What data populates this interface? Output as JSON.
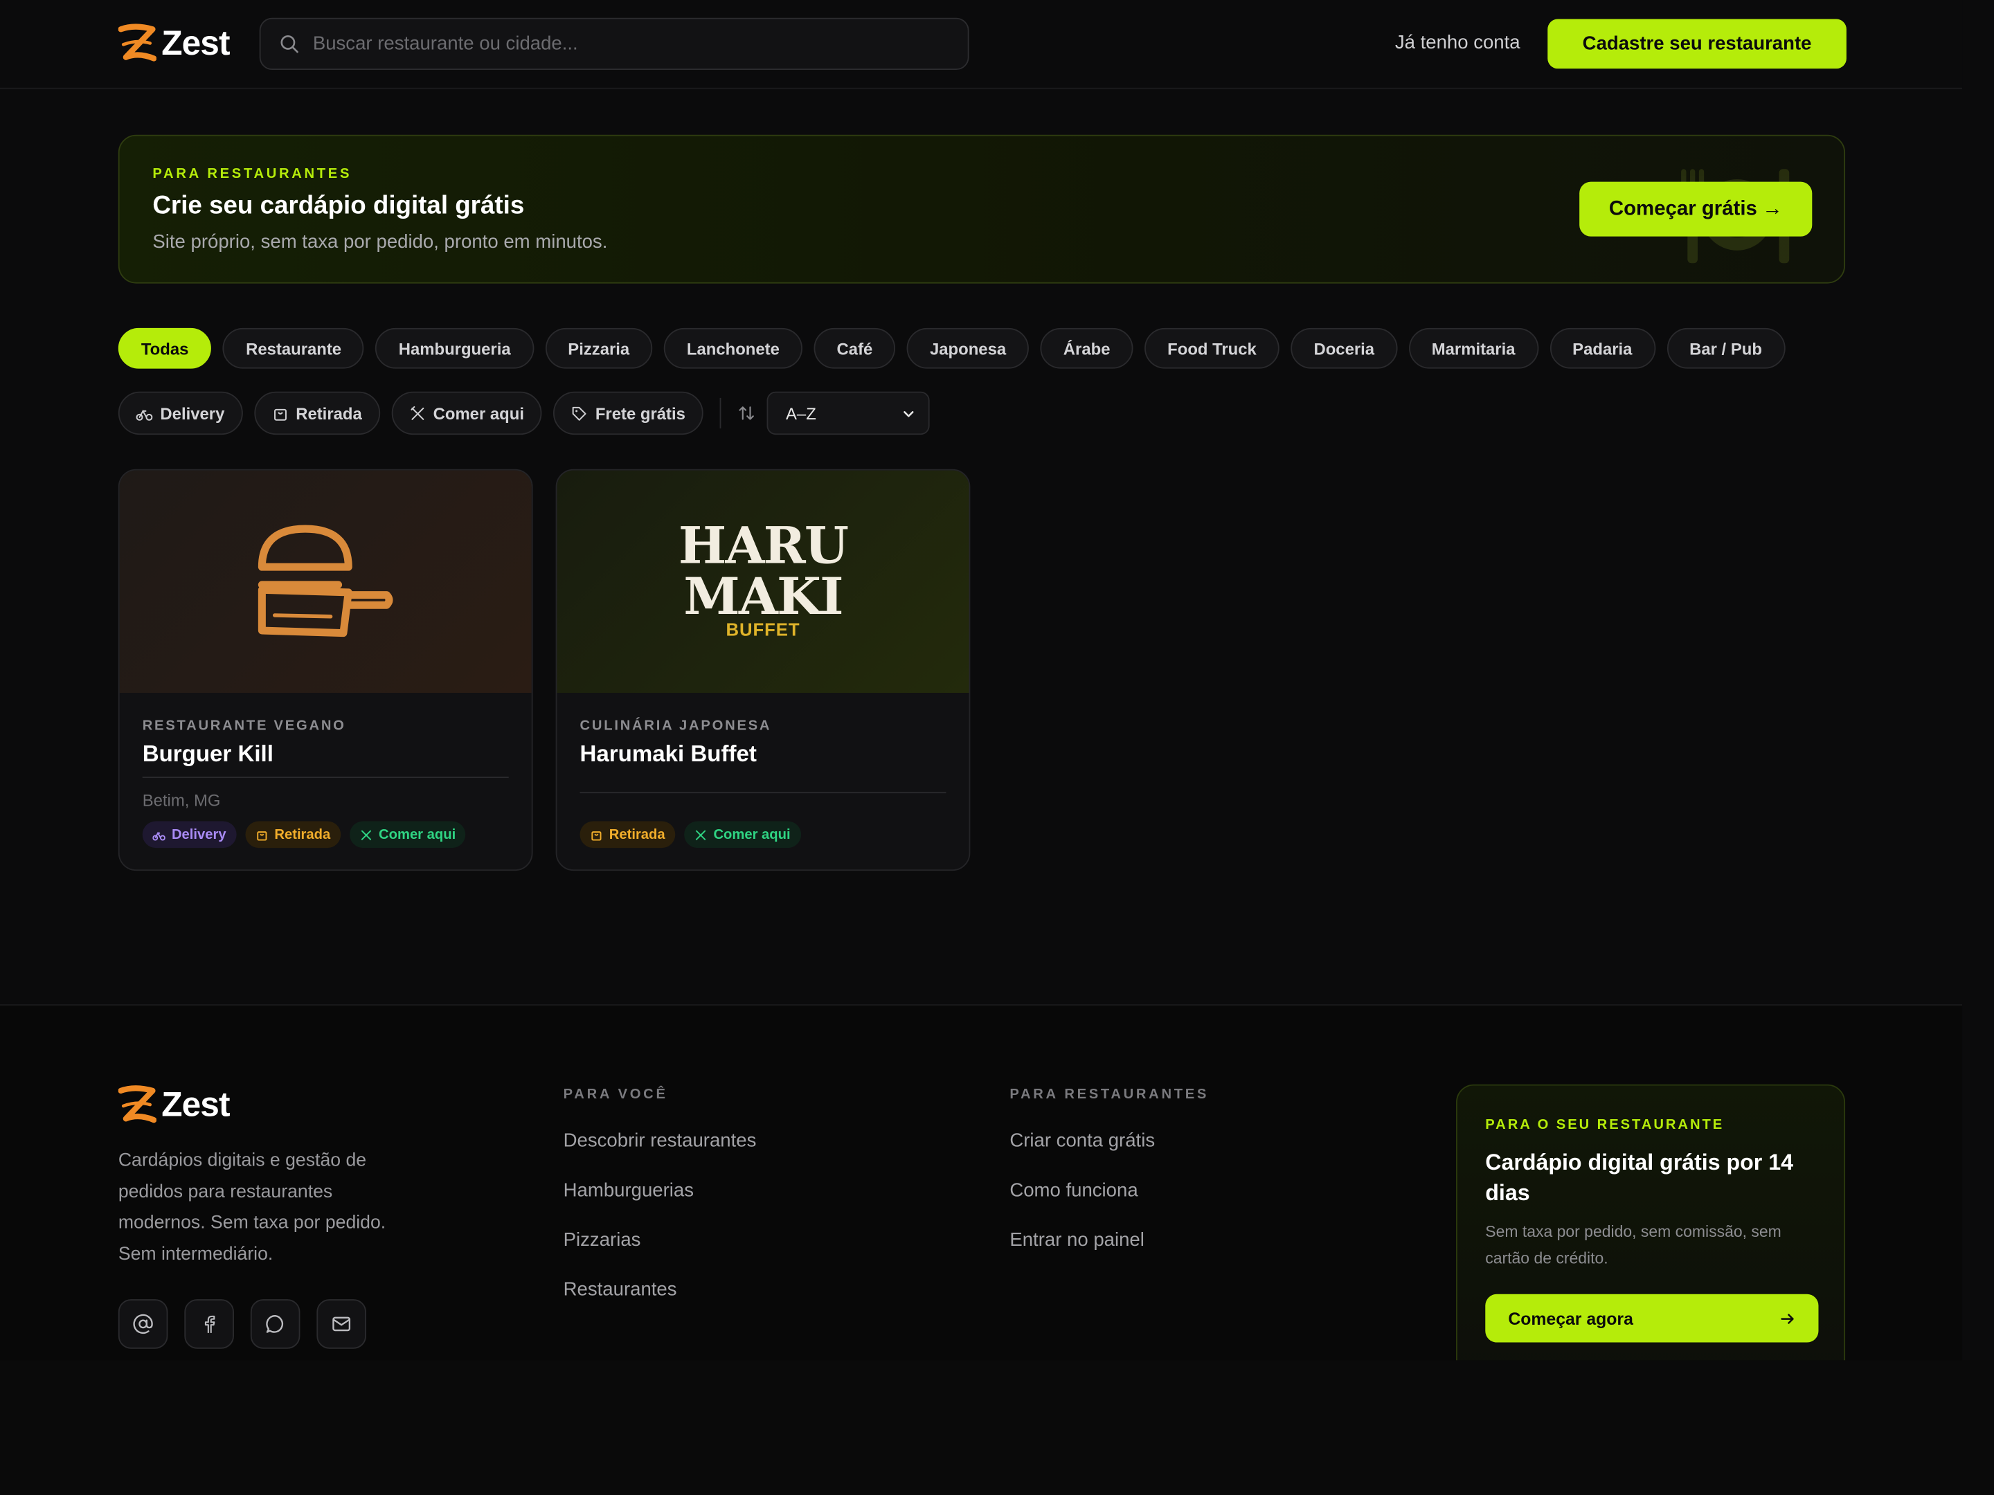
{
  "brand": {
    "name": "Zest",
    "accent": "#b5ec0a",
    "logo_color": "#f08a24"
  },
  "header": {
    "search_placeholder": "Buscar restaurante ou cidade...",
    "login_label": "Já tenho conta",
    "cta_label": "Cadastre seu restaurante"
  },
  "banner": {
    "kicker": "PARA RESTAURANTES",
    "title": "Crie seu cardápio digital grátis",
    "subtitle": "Site próprio, sem taxa por pedido, pronto em minutos.",
    "button_label": "Começar grátis",
    "button_arrow": "→"
  },
  "categories": [
    "Todas",
    "Restaurante",
    "Hamburgueria",
    "Pizzaria",
    "Lanchonete",
    "Café",
    "Japonesa",
    "Árabe",
    "Food Truck",
    "Doceria",
    "Marmitaria",
    "Padaria",
    "Bar / Pub"
  ],
  "filters": {
    "delivery": "Delivery",
    "retirada": "Retirada",
    "comer": "Comer aqui",
    "frete": "Frete grátis",
    "sort_value": "A–Z"
  },
  "cards": [
    {
      "category": "RESTAURANTE VEGANO",
      "name": "Burguer Kill",
      "location": "Betim, MG",
      "tag_delivery": "Delivery",
      "tag_retirada": "Retirada",
      "tag_comer": "Comer aqui"
    },
    {
      "category": "CULINÁRIA JAPONESA",
      "name": "Harumaki Buffet",
      "logo_line1": "HARU",
      "logo_line2": "MAKI",
      "logo_line3": "BUFFET",
      "tag_retirada": "Retirada",
      "tag_comer": "Comer aqui"
    }
  ],
  "footer": {
    "brand_name": "Zest",
    "description": "Cardápios digitais e gestão de pedidos para restaurantes modernos. Sem taxa por pedido. Sem intermediário.",
    "col1_title": "PARA VOCÊ",
    "col1_links": [
      "Descobrir restaurantes",
      "Hamburguerias",
      "Pizzarias",
      "Restaurantes"
    ],
    "col2_title": "PARA RESTAURANTES",
    "col2_links": [
      "Criar conta grátis",
      "Como funciona",
      "Entrar no painel"
    ],
    "card_kicker": "PARA O SEU RESTAURANTE",
    "card_title": "Cardápio digital grátis por 14 dias",
    "card_subtitle": "Sem taxa por pedido, sem comissão, sem cartão de crédito.",
    "card_button": "Começar agora"
  }
}
